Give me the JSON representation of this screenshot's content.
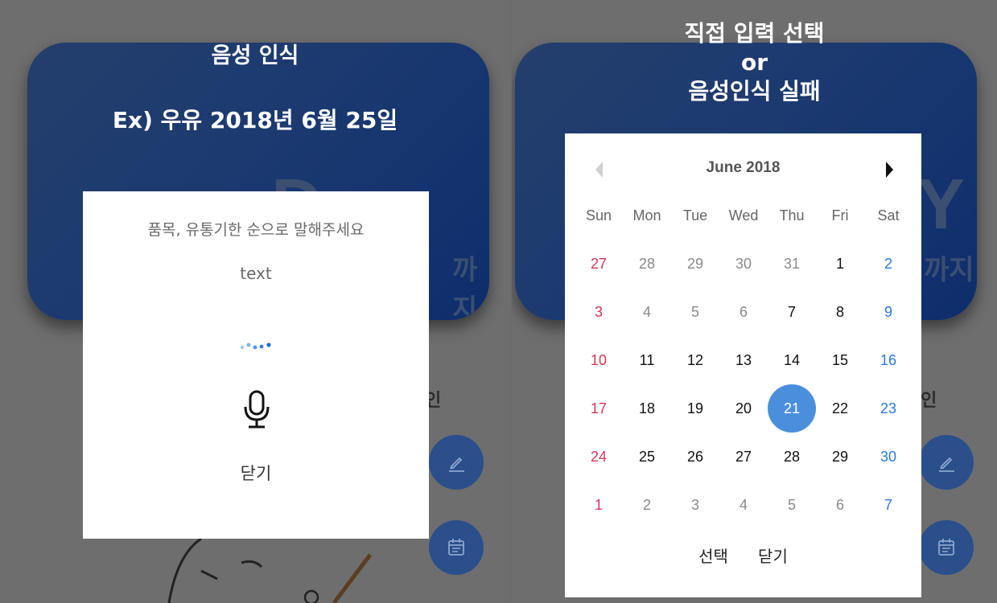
{
  "left": {
    "title_line1": "음성 인식",
    "title_line2": "Ex) 우유 2018년 6월 25일",
    "card_big": "D-DAY",
    "card_until": "까지",
    "bg_text": "인",
    "voice_dialog": {
      "prompt": "품목, 유통기한 순으로 말해주세요",
      "text": "text",
      "close_label": "닫기"
    }
  },
  "right": {
    "title_line1": "직접 입력 선택",
    "title_line2": "or",
    "title_line3": "음성인식 실패",
    "card_big": "Y",
    "card_until": "까지",
    "bg_text": "인",
    "calendar": {
      "month_label": "June 2018",
      "weekdays": [
        "Sun",
        "Mon",
        "Tue",
        "Wed",
        "Thu",
        "Fri",
        "Sat"
      ],
      "weeks": [
        [
          "27",
          "28",
          "29",
          "30",
          "31",
          "1",
          "2"
        ],
        [
          "3",
          "4",
          "5",
          "6",
          "7",
          "8",
          "9"
        ],
        [
          "10",
          "11",
          "12",
          "13",
          "14",
          "15",
          "16"
        ],
        [
          "17",
          "18",
          "19",
          "20",
          "21",
          "22",
          "23"
        ],
        [
          "24",
          "25",
          "26",
          "27",
          "28",
          "29",
          "30"
        ],
        [
          "1",
          "2",
          "3",
          "4",
          "5",
          "6",
          "7"
        ]
      ],
      "selected_day": "21",
      "select_label": "선택",
      "close_label": "닫기"
    }
  },
  "colors": {
    "accent": "#4a8fdc",
    "sunday": "#d7365a",
    "saturday": "#2979e0",
    "card": "#1c3a70"
  }
}
